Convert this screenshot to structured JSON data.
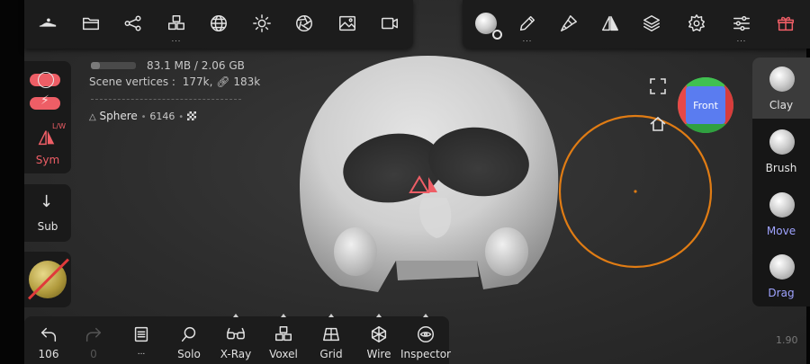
{
  "top_left_toolbar": {
    "items": [
      {
        "name": "scene-icon"
      },
      {
        "name": "folder-icon"
      },
      {
        "name": "share-icon"
      },
      {
        "name": "primitives-icon",
        "dots": "..."
      },
      {
        "name": "grid-sphere-icon"
      },
      {
        "name": "sun-icon"
      },
      {
        "name": "aperture-icon"
      },
      {
        "name": "image-icon"
      },
      {
        "name": "video-icon"
      }
    ]
  },
  "top_right_toolbar": {
    "items": [
      {
        "name": "material-icon"
      },
      {
        "name": "pencil-icon",
        "dots": "..."
      },
      {
        "name": "brush-icon"
      },
      {
        "name": "symmetry-icon"
      },
      {
        "name": "layers-icon"
      },
      {
        "name": "settings-icon"
      },
      {
        "name": "sliders-icon",
        "dots": "..."
      },
      {
        "name": "gift-icon"
      }
    ]
  },
  "info": {
    "memory": "83.1 MB / 2.06 GB",
    "memory_fraction": 0.04,
    "scene_vertices_label": "Scene vertices :",
    "scene_vertices": "177k",
    "scene_links": "183k",
    "object_name": "Sphere",
    "object_count": "6146"
  },
  "left_panel": {
    "sym_label": "Sym",
    "lw_label": "L/W",
    "sub_label": "Sub"
  },
  "right_panel": {
    "tools": [
      {
        "label": "Clay"
      },
      {
        "label": "Brush"
      },
      {
        "label": "Move"
      },
      {
        "label": "Drag"
      }
    ]
  },
  "view_cube": {
    "label": "Front"
  },
  "bottom_toolbar": {
    "undo_count": "106",
    "redo_count": "0",
    "items": [
      {
        "label": "Solo"
      },
      {
        "label": "X-Ray"
      },
      {
        "label": "Voxel"
      },
      {
        "label": "Grid"
      },
      {
        "label": "Wire"
      },
      {
        "label": "Inspector"
      }
    ],
    "book_dots": "..."
  },
  "version": "1.90",
  "colors": {
    "accent_red": "#ee5e66",
    "accent_blue": "#9fa3ff",
    "brush_ring": "#e07c14"
  }
}
